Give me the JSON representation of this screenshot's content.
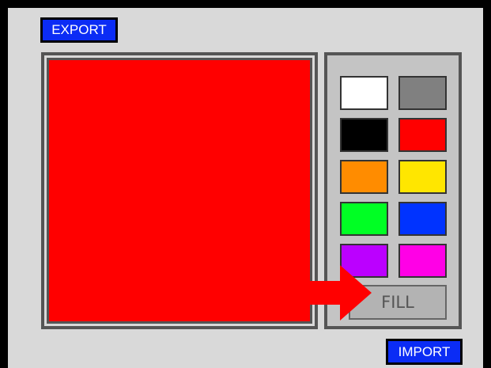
{
  "toolbar": {
    "export_label": "EXPORT",
    "import_label": "IMPORT"
  },
  "canvas": {
    "fill_color": "#ff0000"
  },
  "palette": {
    "swatches": [
      {
        "name": "white",
        "color": "#ffffff"
      },
      {
        "name": "gray",
        "color": "#808080"
      },
      {
        "name": "black",
        "color": "#000000"
      },
      {
        "name": "red",
        "color": "#ff0000"
      },
      {
        "name": "orange",
        "color": "#ff8c00"
      },
      {
        "name": "yellow",
        "color": "#ffe600"
      },
      {
        "name": "green",
        "color": "#00ff24"
      },
      {
        "name": "blue",
        "color": "#0033ff"
      },
      {
        "name": "purple",
        "color": "#bb00ff"
      },
      {
        "name": "magenta",
        "color": "#ff00e6"
      }
    ],
    "fill_label": "FILL"
  },
  "colors": {
    "button_blue": "#0b2cf5",
    "arrow": "#ff0000",
    "background": "#d9d9d9",
    "frame": "#555555"
  },
  "annotation": {
    "icon": "arrow-right-icon"
  }
}
